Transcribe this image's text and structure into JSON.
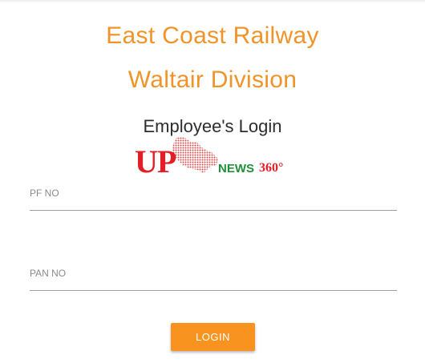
{
  "header": {
    "title_line1": "East Coast Railway",
    "title_line2": "Waltair Division",
    "subtitle": "Employee's Login",
    "accent_color": "#f0942a"
  },
  "watermark": {
    "logo_up": "UP",
    "logo_news": "NEWS",
    "logo_360": "360°"
  },
  "form": {
    "pf_label": "PF NO",
    "pf_value": "",
    "pan_label": "PAN NO",
    "pan_value": "",
    "login_label": "LOGIN",
    "button_color": "#f7931e"
  }
}
